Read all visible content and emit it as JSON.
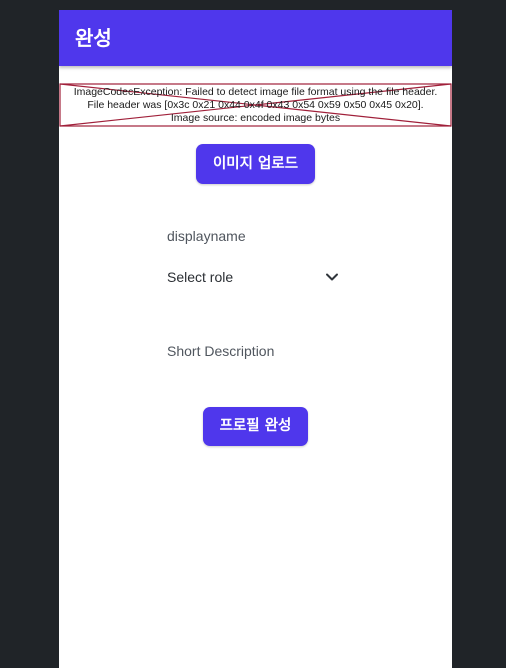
{
  "appbar": {
    "title": "완성"
  },
  "image_error": {
    "line1": "ImageCodecException: Failed to detect image file format using the file header.",
    "line2": "File header was [0x3c 0x21 0x44 0x4f 0x43 0x54 0x59 0x50 0x45 0x20].",
    "line3": "Image source: encoded image bytes"
  },
  "upload_button": {
    "label": "이미지 업로드"
  },
  "display_name_field": {
    "placeholder": "displayname"
  },
  "role_select": {
    "value": "Select role"
  },
  "description_field": {
    "placeholder": "Short Description"
  },
  "complete_button": {
    "label": "프로필 완성"
  },
  "colors": {
    "accent": "#4f37ec",
    "page_background": "#202428",
    "surface": "#ffffff",
    "error_border": "#a0203a"
  },
  "icons": {
    "select_chevron": "chevron-down-icon"
  }
}
